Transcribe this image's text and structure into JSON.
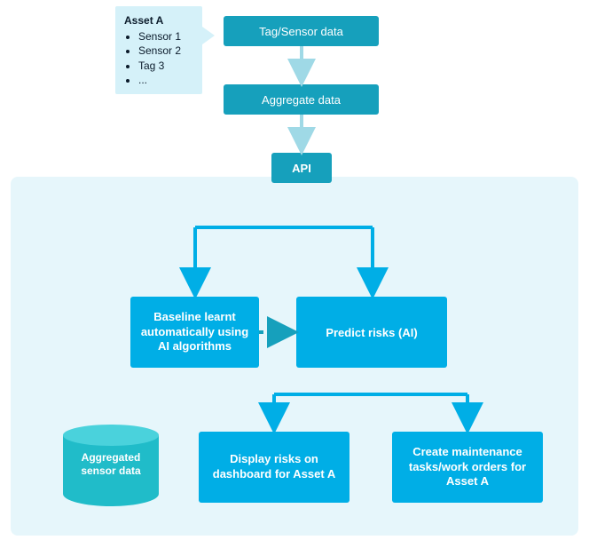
{
  "legend": {
    "title": "Asset A",
    "items": [
      "Sensor 1",
      "Sensor 2",
      "Tag 3",
      "..."
    ]
  },
  "nodes": {
    "tag_sensor": "Tag/Sensor data",
    "aggregate": "Aggregate data",
    "api": "API",
    "baseline": "Baseline learnt automatically using AI algorithms",
    "predict": "Predict risks (AI)",
    "display": "Display risks on dashboard for Asset A",
    "create": "Create maintenance tasks/work orders for Asset A"
  },
  "cylinder": {
    "label": "Aggregated sensor data"
  },
  "chart_data": {
    "type": "diagram",
    "nodes": [
      {
        "id": "asset_a",
        "label": "Asset A",
        "details": [
          "Sensor 1",
          "Sensor 2",
          "Tag 3",
          "..."
        ]
      },
      {
        "id": "tag_sensor",
        "label": "Tag/Sensor data"
      },
      {
        "id": "aggregate",
        "label": "Aggregate data"
      },
      {
        "id": "api",
        "label": "API"
      },
      {
        "id": "baseline",
        "label": "Baseline learnt automatically using AI algorithms"
      },
      {
        "id": "predict",
        "label": "Predict risks (AI)"
      },
      {
        "id": "display",
        "label": "Display risks on dashboard for Asset A"
      },
      {
        "id": "create",
        "label": "Create maintenance tasks/work orders for Asset A"
      },
      {
        "id": "store",
        "label": "Aggregated sensor data",
        "shape": "cylinder"
      }
    ],
    "edges": [
      {
        "from": "asset_a",
        "to": "tag_sensor",
        "style": "pointer"
      },
      {
        "from": "tag_sensor",
        "to": "aggregate"
      },
      {
        "from": "aggregate",
        "to": "api"
      },
      {
        "from": "api",
        "to": "baseline"
      },
      {
        "from": "api",
        "to": "predict"
      },
      {
        "from": "baseline",
        "to": "predict",
        "style": "dashed"
      },
      {
        "from": "predict",
        "to": "display"
      },
      {
        "from": "predict",
        "to": "create"
      }
    ],
    "container_group": [
      "api",
      "baseline",
      "predict",
      "display",
      "create",
      "store"
    ]
  }
}
